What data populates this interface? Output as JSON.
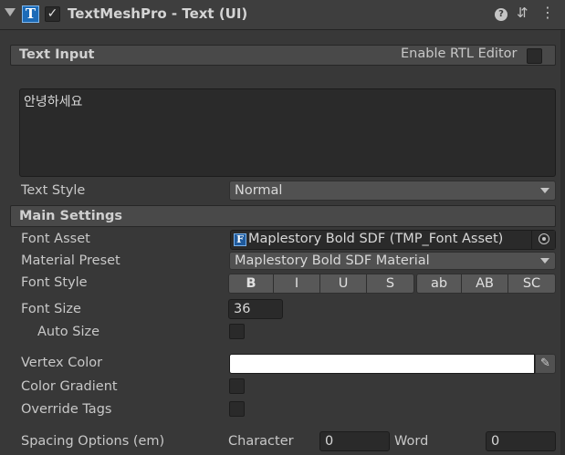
{
  "component": {
    "title": "TextMeshPro - Text (UI)",
    "icon": "tmp-text-icon",
    "icon_glyph": "T",
    "enabled": true
  },
  "text_input": {
    "section_title": "Text Input",
    "rtl_label": "Enable RTL Editor",
    "rtl_enabled": false,
    "text_value": "안녕하세요"
  },
  "text_style": {
    "label": "Text Style",
    "value": "Normal"
  },
  "main_settings": {
    "section_title": "Main Settings",
    "font_asset": {
      "label": "Font Asset",
      "icon_glyph": "F",
      "value": "Maplestory Bold SDF (TMP_Font Asset)"
    },
    "material_preset": {
      "label": "Material Preset",
      "value": "Maplestory Bold SDF Material"
    },
    "font_style": {
      "label": "Font Style",
      "buttons": [
        "B",
        "I",
        "U",
        "S",
        "ab",
        "AB",
        "SC"
      ]
    },
    "font_size": {
      "label": "Font Size",
      "value": "36"
    },
    "auto_size": {
      "label": "Auto Size",
      "enabled": false
    },
    "vertex_color": {
      "label": "Vertex Color",
      "color": "#ffffff"
    },
    "color_gradient": {
      "label": "Color Gradient",
      "enabled": false
    },
    "override_tags": {
      "label": "Override Tags",
      "enabled": false
    },
    "spacing": {
      "label": "Spacing Options (em)",
      "character_label": "Character",
      "character_value": "0",
      "word_label": "Word",
      "word_value": "0"
    }
  },
  "glyphs": {
    "check": "✓",
    "help": "?",
    "presets": "⇵",
    "menu": "⋮",
    "eyedropper": "✎"
  },
  "colors": {
    "background": "#383838",
    "header": "#3e3e3e",
    "field": "#2a2a2a",
    "accent_blue": "#1c6bb8"
  }
}
